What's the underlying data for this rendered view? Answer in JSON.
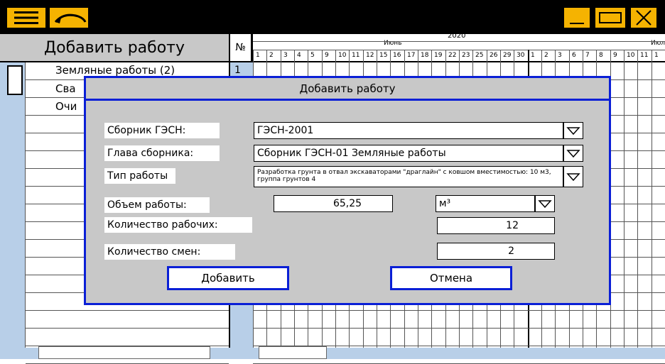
{
  "colors": {
    "accent": "#f5b301",
    "dialog_border": "#0a1fd6",
    "panel": "#c8c8c8",
    "strip": "#b8cfe8"
  },
  "sidebar": {
    "header": "Добавить работу",
    "num_header": "№",
    "tasks": [
      {
        "label": "Земляные работы (2)",
        "num": "1"
      },
      {
        "label": "Сва",
        "num": ""
      },
      {
        "label": "Очи",
        "num": ""
      }
    ]
  },
  "calendar": {
    "year": "2020",
    "month1": "Июнь",
    "month2": "Июл",
    "days": [
      "1",
      "2",
      "3",
      "4",
      "5",
      "9",
      "10",
      "11",
      "12",
      "15",
      "16",
      "17",
      "18",
      "19",
      "22",
      "23",
      "25",
      "26",
      "29",
      "30",
      "1",
      "2",
      "3",
      "6",
      "7",
      "8",
      "9",
      "10",
      "11",
      "1"
    ]
  },
  "dialog": {
    "title": "Добавить работу",
    "collection_label": "Сборник ГЭСН:",
    "collection_value": "ГЭСН-2001",
    "chapter_label": "Глава сборника:",
    "chapter_value": "Сборник ГЭСН-01 Земляные работы",
    "worktype_label": "Тип работы",
    "worktype_value": "Разработка грунта в отвал экскаваторами \"драглайн\" с ковшом вместимостью: 10 м3, группа грунтов 4",
    "volume_label": "Объем работы:",
    "volume_value": "65,25",
    "unit_value": "м³",
    "workers_label": "Количество рабочих:",
    "workers_value": "12",
    "shifts_label": "Количество смен:",
    "shifts_value": "2",
    "add_button": "Добавить",
    "cancel_button": "Отмена"
  }
}
